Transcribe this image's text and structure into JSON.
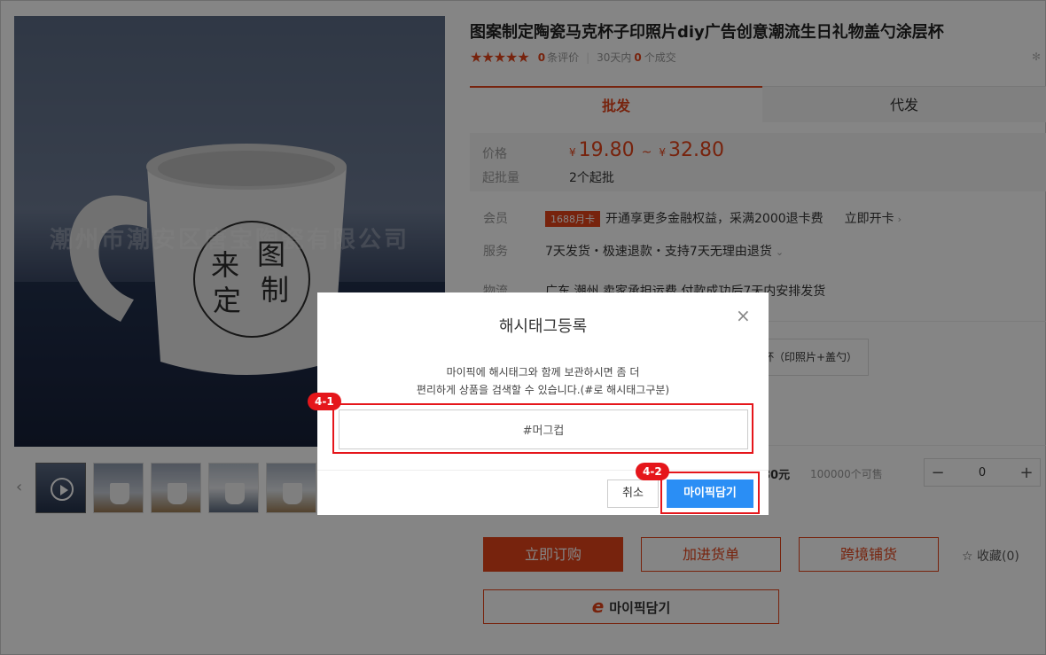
{
  "product": {
    "title": "图案制定陶瓷马克杯子印照片diy广告创意潮流生日礼物盖勺涂层杯",
    "stars": "★★★★★",
    "review_count": "0",
    "review_label": "条评价",
    "sold_prefix": "30天内",
    "sold_count": "0",
    "sold_suffix": "个成交",
    "watermark": "潮州市潮安区唐宝陶瓷有限公司",
    "mug_text": [
      "来",
      "图",
      "定",
      "制"
    ]
  },
  "tabs": [
    {
      "label": "批发",
      "active": true
    },
    {
      "label": "代发",
      "active": false
    }
  ],
  "price": {
    "label": "价格",
    "currency": "¥",
    "min": "19.80",
    "tilde": "~",
    "max": "32.80",
    "min_order_label": "起批量",
    "min_order_value": "2个起批"
  },
  "member": {
    "label": "会员",
    "badge": "1688月卡",
    "text": "开通享更多金融权益，采满2000退卡费",
    "link": "立即开卡"
  },
  "service": {
    "label": "服务",
    "text": "7天发货・极速退款・支持7天无理由退货"
  },
  "logistics": {
    "label": "物流",
    "text": "广东 潮州    卖家承担运费    付款成功后7天内安排发货"
  },
  "spec_option": "杯（印照片+盖勺）",
  "sku": {
    "price": "80元",
    "available": "100000个可售",
    "quantity": "0",
    "minus": "−",
    "plus": "+"
  },
  "actions": {
    "buy": "立即订购",
    "cart": "加进货单",
    "cross": "跨境铺货",
    "favorite": "收藏(0)",
    "mypick": "마이픽담기"
  },
  "modal": {
    "title": "해시태그등록",
    "close": "×",
    "desc_line1": "마이픽에 해시태그와 함께 보관하시면 좀 더",
    "desc_line2": "편리하게 상품을 검색할 수 있습니다.(#로 해시태그구분)",
    "input_value": "#머그컵",
    "cancel": "취소",
    "submit": "마이픽담기"
  },
  "annotations": {
    "tag1": "4-1",
    "tag2": "4-2"
  },
  "colors": {
    "accent": "#e4431a",
    "primary_button": "#2a8ef5",
    "annotation": "#e5161b"
  }
}
